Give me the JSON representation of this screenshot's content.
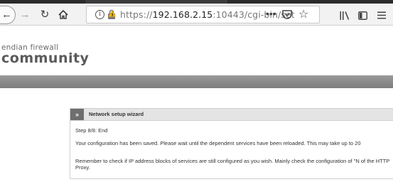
{
  "browser": {
    "url_scheme": "https://",
    "url_host": "192.168.2.15",
    "url_rest": ":10443/cgi-bin/set",
    "more_label": "•••",
    "info_label": "i"
  },
  "logo": {
    "line1": "endian firewall",
    "line2": "community"
  },
  "wizard": {
    "chevron": "»",
    "title": "Network setup wizard",
    "step": "Step 8/8: End",
    "message1": "Your configuration has been saved. Please wait until the dependent services have been reloaded. This may take up to 20",
    "message2": "Remember to check if IP address blocks of services are still configured as you wish. Mainly check the configuration of \"N of the HTTP Proxy."
  }
}
